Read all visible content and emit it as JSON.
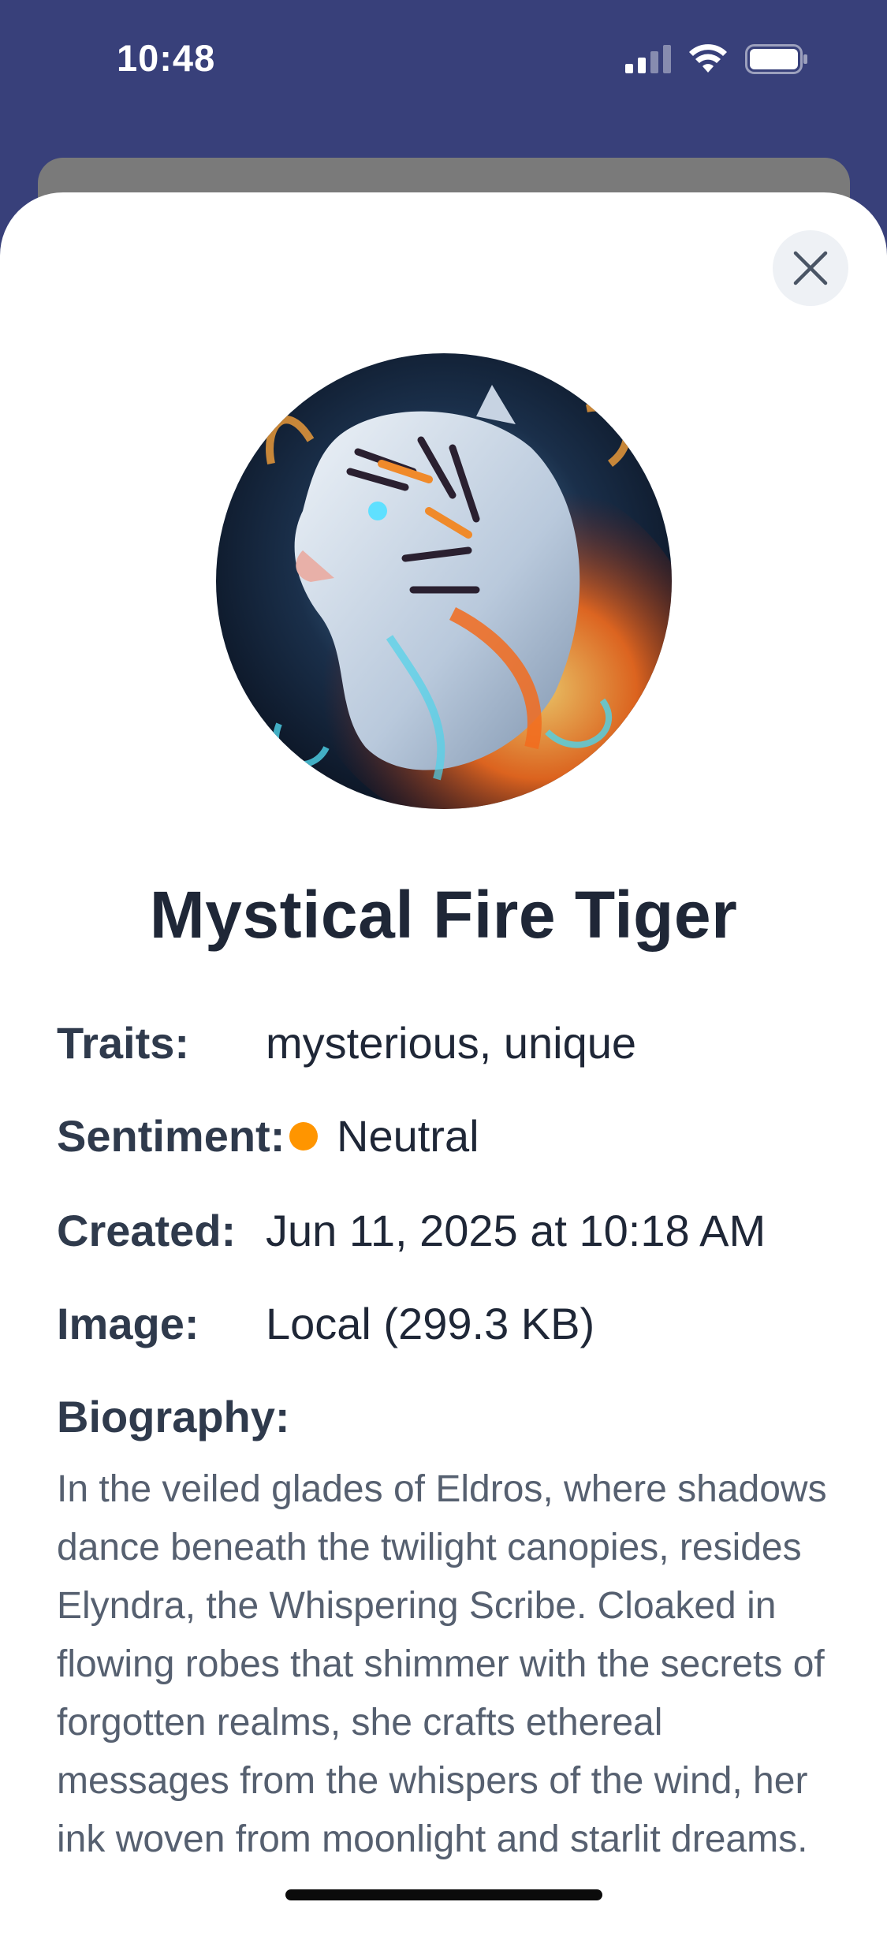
{
  "status_bar": {
    "time": "10:48",
    "icons": [
      "cellular-signal-icon",
      "wifi-icon",
      "battery-icon"
    ]
  },
  "sheet": {
    "close_icon": "close-icon",
    "avatar_description_icon": "tiger-portrait-image",
    "title": "Mystical Fire Tiger",
    "details": {
      "traits_label": "Traits:",
      "traits_value": "mysterious, unique",
      "sentiment_label": "Sentiment:",
      "sentiment_value": "Neutral",
      "sentiment_color": "#ff9500",
      "created_label": "Created:",
      "created_value": "Jun 11, 2025 at 10:18 AM",
      "image_label": "Image:",
      "image_value": "Local (299.3 KB)"
    },
    "biography_label": "Biography:",
    "biography_text": "In the veiled glades of Eldros, where shadows dance beneath the twilight canopies, resides Elyndra, the Whispering Scribe. Cloaked in flowing robes that shimmer with the secrets of forgotten realms, she crafts ethereal messages from the whispers of the wind, her ink woven from moonlight and starlit dreams."
  },
  "colors": {
    "header_bg": "#38407a",
    "title_text": "#1f2737",
    "body_text": "#566070",
    "accent_sentiment": "#ff9500"
  }
}
